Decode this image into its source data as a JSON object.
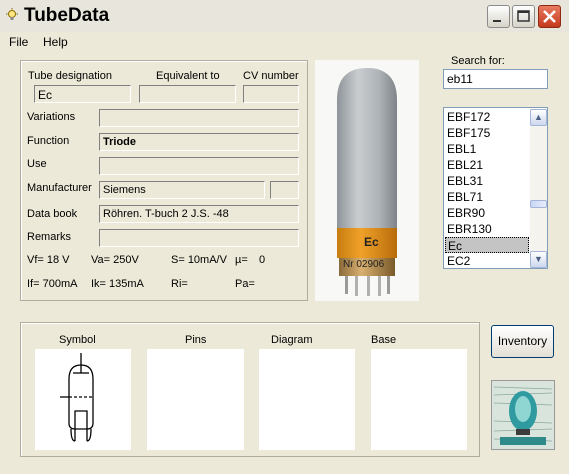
{
  "window": {
    "title": "TubeData",
    "icon": "bulb-icon"
  },
  "menu": {
    "file": "File",
    "help": "Help"
  },
  "labels": {
    "designation": "Tube designation",
    "equivalent": "Equivalent to",
    "cv": "CV number",
    "variations": "Variations",
    "function": "Function",
    "use": "Use",
    "manufacturer": "Manufacturer",
    "databook": "Data book",
    "remarks": "Remarks",
    "search": "Search for:"
  },
  "values": {
    "designation": "Ec",
    "equivalent": "",
    "cv": "",
    "variations": "",
    "function": "Triode",
    "use": "",
    "manufacturer": "Siemens",
    "manufacturer_extra": "",
    "databook": "Röhren. T-buch 2 J.S. -48",
    "remarks": "",
    "search": "eb11"
  },
  "params": {
    "vf": "Vf= 18 V",
    "va": "Va= 250V",
    "s": "S= 10mA/V",
    "mu": "µ=",
    "mu_val": "0",
    "if": "If= 700mA",
    "ik": "Ik= 135mA",
    "ri": "Ri=",
    "pa": "Pa="
  },
  "tube_image": {
    "label": "Ec",
    "serial": "Nr 02906"
  },
  "list": {
    "items": [
      "EBF172",
      "EBF175",
      "EBL1",
      "EBL21",
      "EBL31",
      "EBL71",
      "EBR90",
      "EBR130",
      "Ec",
      "EC2"
    ],
    "selected": "Ec"
  },
  "bottom": {
    "symbol": "Symbol",
    "pins": "Pins",
    "diagram": "Diagram",
    "base": "Base"
  },
  "inventory_button": "Inventory"
}
